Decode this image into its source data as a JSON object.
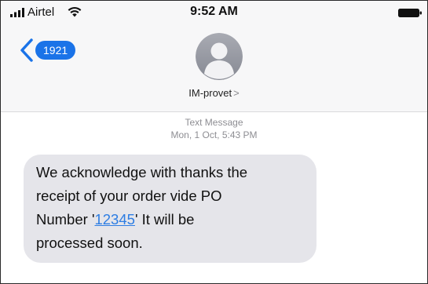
{
  "status_bar": {
    "carrier": "Airtel",
    "time": "9:52 AM",
    "signal_icon": "signal-bars-icon",
    "wifi_icon": "wifi-icon",
    "battery_icon": "battery-icon"
  },
  "nav": {
    "back_badge": "1921",
    "back_icon": "chevron-left-icon",
    "contact_name": "IM-provet",
    "contact_chevron": ">",
    "avatar_icon": "person-avatar-icon"
  },
  "thread": {
    "meta_kind": "Text Message",
    "meta_date": "Mon, 1 Oct, 5:43 PM"
  },
  "message": {
    "line1": "We acknowledge with thanks the",
    "line2": "receipt of your order vide PO",
    "line3_prefix": "Number '",
    "po_number": "12345",
    "line3_suffix": "' It will be",
    "line4": "processed soon."
  },
  "colors": {
    "accent": "#1a73e8",
    "link": "#2d7de3",
    "bubble": "#e5e5ea",
    "meta_text": "#8e8e93"
  }
}
